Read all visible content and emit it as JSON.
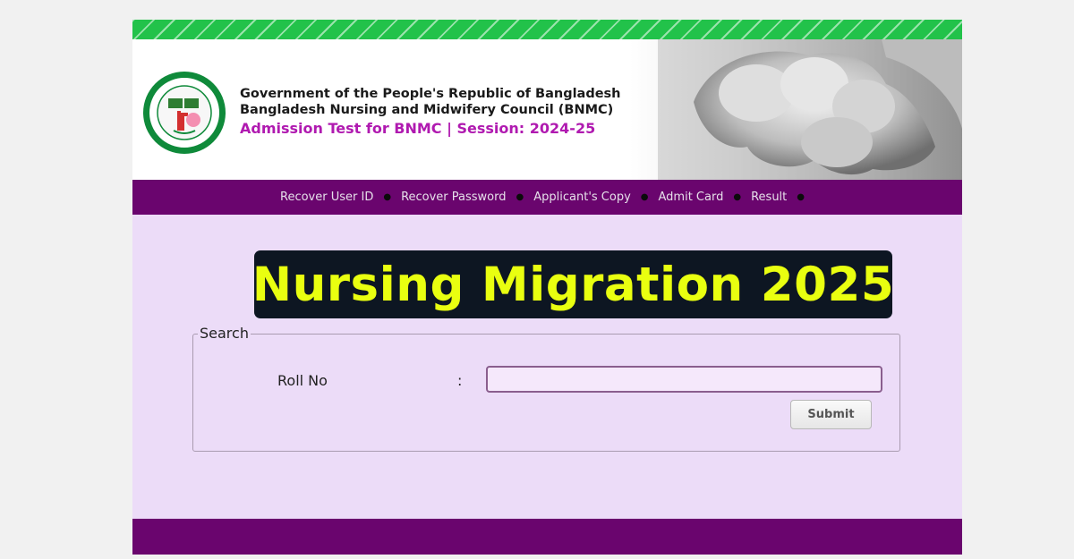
{
  "header": {
    "gov_line1": "Government of the People's Republic of Bangladesh",
    "gov_line2": "Bangladesh Nursing and Midwifery Council (BNMC)",
    "admission_line": "Admission Test for BNMC | Session: 2024-25"
  },
  "nav": {
    "items": [
      {
        "label": "Recover User ID"
      },
      {
        "label": "Recover Password"
      },
      {
        "label": "Applicant's Copy"
      },
      {
        "label": "Admit Card"
      },
      {
        "label": "Result"
      }
    ]
  },
  "banner": {
    "text": "Nursing Migration 2025"
  },
  "search": {
    "legend": "Search",
    "roll_label": "Roll No",
    "colon": ":",
    "roll_value": "",
    "submit_label": "Submit"
  },
  "colors": {
    "stripe_green": "#22c24a",
    "nav_purple": "#6a056e",
    "body_lavender": "#ecdcf8",
    "admission_magenta": "#b01ab0",
    "banner_bg": "#0d1622",
    "banner_text": "#e9ff10"
  },
  "icons": {
    "logo": "bnmc-logo-icon",
    "photo": "baby-hand-photo"
  }
}
